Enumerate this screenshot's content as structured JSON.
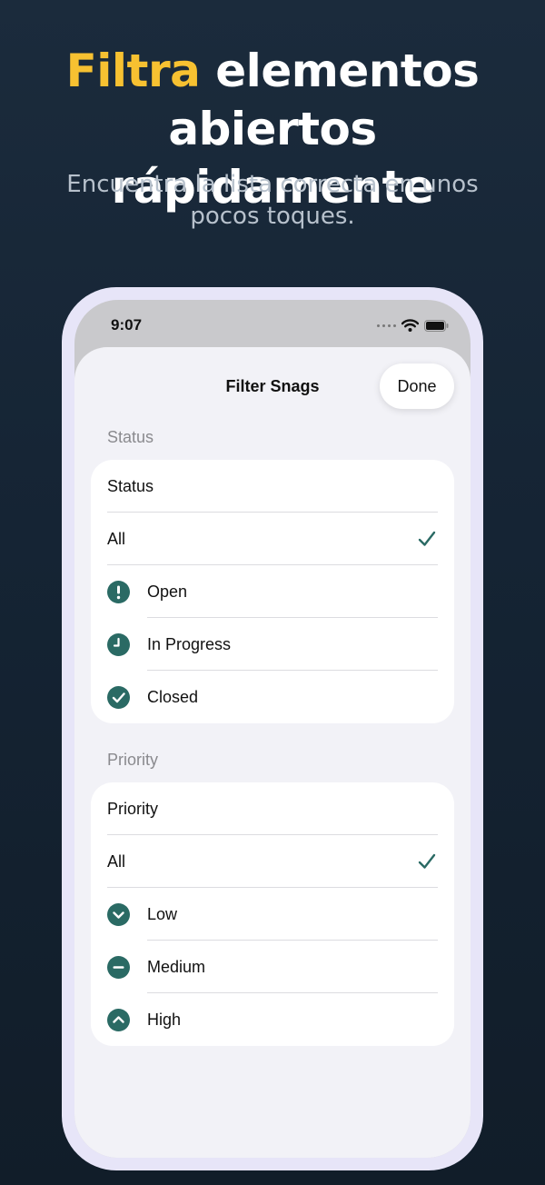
{
  "promo": {
    "headline_accent": "Filtra",
    "headline_rest_line1": " elementos",
    "headline_line2": "abiertos rápidamente",
    "subtitle": "Encuentra la lista correcta en unos pocos toques.",
    "accent_color": "#f7c131"
  },
  "device": {
    "status_bar": {
      "time": "9:07",
      "icons": [
        "signal-dots-icon",
        "wifi-icon",
        "battery-icon"
      ]
    }
  },
  "sheet": {
    "title": "Filter Snags",
    "done_label": "Done",
    "status_section": {
      "header": "Status",
      "picker_label": "Status",
      "options": [
        {
          "label": "All",
          "icon": null,
          "selected": true
        },
        {
          "label": "Open",
          "icon": "exclamation-circle-icon",
          "selected": false
        },
        {
          "label": "In Progress",
          "icon": "clock-circle-icon",
          "selected": false
        },
        {
          "label": "Closed",
          "icon": "checkmark-circle-icon",
          "selected": false
        }
      ]
    },
    "priority_section": {
      "header": "Priority",
      "picker_label": "Priority",
      "options": [
        {
          "label": "All",
          "icon": null,
          "selected": true
        },
        {
          "label": "Low",
          "icon": "chevron-down-circle-icon",
          "selected": false
        },
        {
          "label": "Medium",
          "icon": "minus-circle-icon",
          "selected": false
        },
        {
          "label": "High",
          "icon": "chevron-up-circle-icon",
          "selected": false
        }
      ]
    },
    "tint_color": "#2a6a64"
  }
}
